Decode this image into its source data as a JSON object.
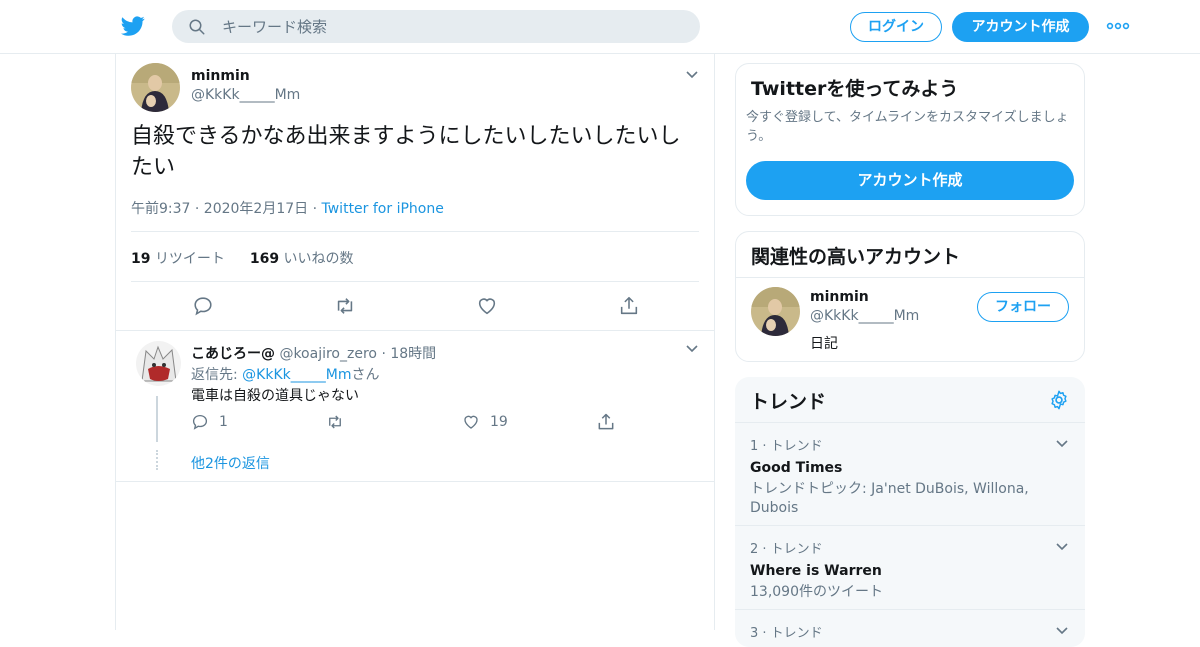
{
  "header": {
    "search_placeholder": "キーワード検索",
    "login_label": "ログイン",
    "signup_label": "アカウント作成"
  },
  "tweet": {
    "name": "minmin",
    "handle": "@KkKk_____Mm",
    "text": "自殺できるかなあ出来ますようにしたいしたいしたいしたい",
    "time": "午前9:37 · 2020年2月17日",
    "source": "Twitter for iPhone",
    "retweet_count": "19",
    "retweet_label": "リツイート",
    "like_count": "169",
    "like_label": "いいねの数"
  },
  "reply": {
    "name": "こあじろー@",
    "handle": "@koajiro_zero",
    "time": "· 18時間",
    "replying_prefix": "返信先: ",
    "replying_handle": "@KkKk_____Mm",
    "replying_suffix": "さん",
    "text": "電車は自殺の道具じゃない",
    "reply_count": "1",
    "like_count": "19",
    "more_replies": "他2件の返信"
  },
  "sidebar": {
    "promo": {
      "title": "Twitterを使ってみよう",
      "desc": "今すぐ登録して、タイムラインをカスタマイズしましょう。",
      "button": "アカウント作成"
    },
    "related": {
      "title": "関連性の高いアカウント",
      "name": "minmin",
      "handle": "@KkKk_____Mm",
      "bio": "日記",
      "follow": "フォロー"
    },
    "trends": {
      "title": "トレンド",
      "items": [
        {
          "meta": "1 · トレンド",
          "name": "Good Times",
          "desc": "トレンドトピック: Ja'net DuBois, Willona, Dubois"
        },
        {
          "meta": "2 · トレンド",
          "name": "Where is Warren",
          "desc": "13,090件のツイート"
        },
        {
          "meta": "3 · トレンド",
          "name": "",
          "desc": ""
        }
      ]
    }
  },
  "colors": {
    "accent": "#1da1f2",
    "link": "#1b95e0",
    "muted": "#657786",
    "border": "#e6ecf0"
  }
}
